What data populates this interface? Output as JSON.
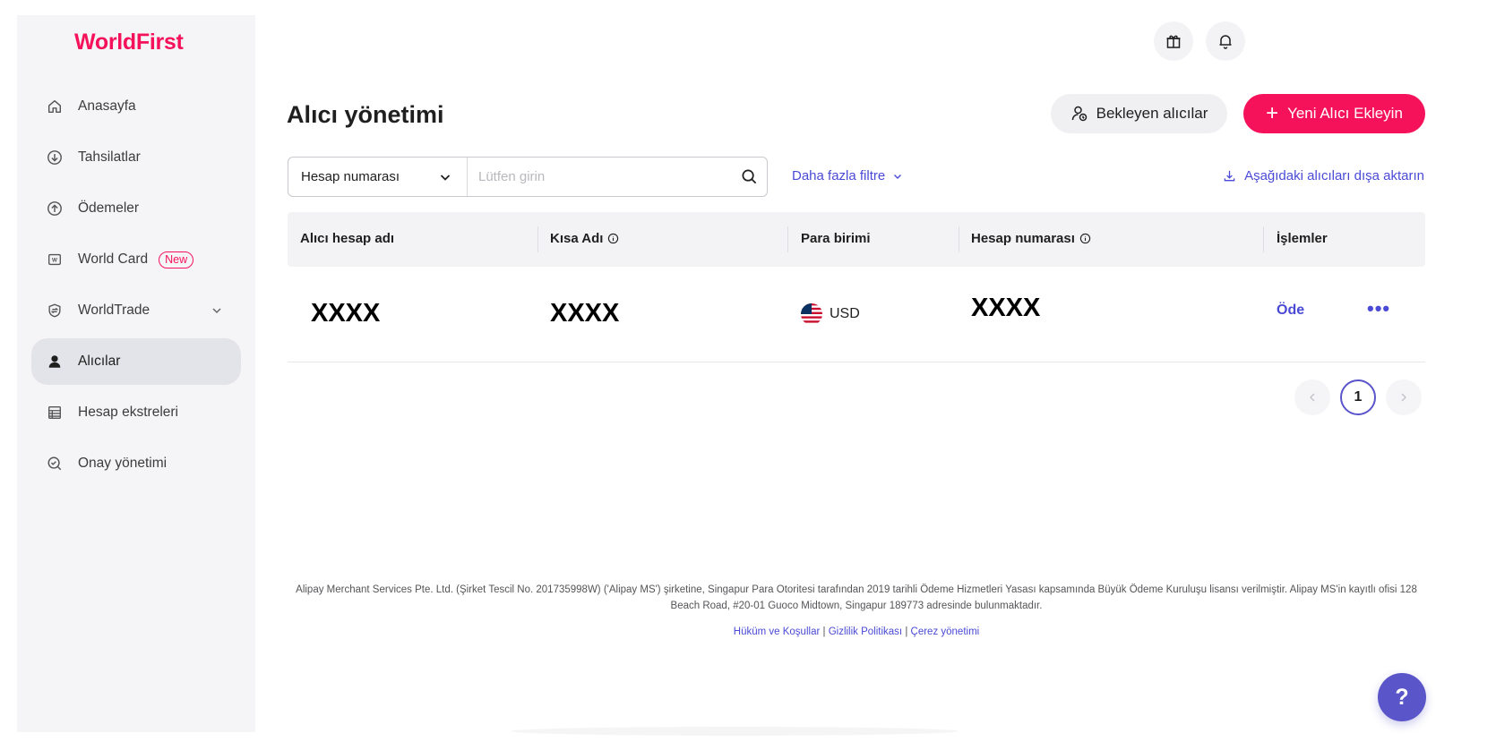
{
  "brand": {
    "logo_text": "WorldFirst",
    "accent_color": "#f5125b",
    "link_color": "#4a4ad6"
  },
  "sidebar": {
    "items": [
      {
        "label": "Anasayfa",
        "icon": "home-icon",
        "active": false
      },
      {
        "label": "Tahsilatlar",
        "icon": "download-circle-icon",
        "active": false
      },
      {
        "label": "Ödemeler",
        "icon": "upload-circle-icon",
        "active": false
      },
      {
        "label": "World Card",
        "icon": "card-icon",
        "badge": "New",
        "active": false
      },
      {
        "label": "WorldTrade",
        "icon": "trade-shield-icon",
        "expandable": true,
        "active": false
      },
      {
        "label": "Alıcılar",
        "icon": "user-icon",
        "active": true
      },
      {
        "label": "Hesap ekstreleri",
        "icon": "statement-icon",
        "active": false
      },
      {
        "label": "Onay yönetimi",
        "icon": "approval-icon",
        "active": false
      }
    ]
  },
  "topbar": {
    "icons": [
      "gift-icon",
      "bell-icon"
    ]
  },
  "header": {
    "title": "Alıcı yönetimi",
    "pending_button": "Bekleyen alıcılar",
    "add_button": "Yeni Alıcı Ekleyin"
  },
  "search": {
    "select_value": "Hesap numarası",
    "placeholder": "Lütfen girin",
    "more_filters": "Daha fazla filtre",
    "export": "Aşağıdaki alıcıları dışa aktarın"
  },
  "table": {
    "columns": [
      "Alıcı hesap adı",
      "Kısa Adı",
      "Para birimi",
      "Hesap numarası",
      "İşlemler"
    ],
    "rows": [
      {
        "account_name": "XXXX",
        "short_name": "XXXX",
        "currency": "USD",
        "account_number": "XXXX",
        "action": "Öde"
      }
    ]
  },
  "pagination": {
    "current_page": "1"
  },
  "footer": {
    "text": "Alipay Merchant Services Pte. Ltd. (Şirket Tescil No. 201735998W) ('Alipay MS') şirketine, Singapur Para Otoritesi tarafından 2019 tarihli Ödeme Hizmetleri Yasası kapsamında Büyük Ödeme Kuruluşu lisansı verilmiştir. Alipay MS'in kayıtlı ofisi 128 Beach Road, #20-01 Guoco Midtown, Singapur 189773 adresinde bulunmaktadır.",
    "links": [
      "Hüküm ve Koşullar",
      "Gizlilik Politikası",
      "Çerez yönetimi"
    ]
  },
  "help": {
    "label": "?"
  }
}
